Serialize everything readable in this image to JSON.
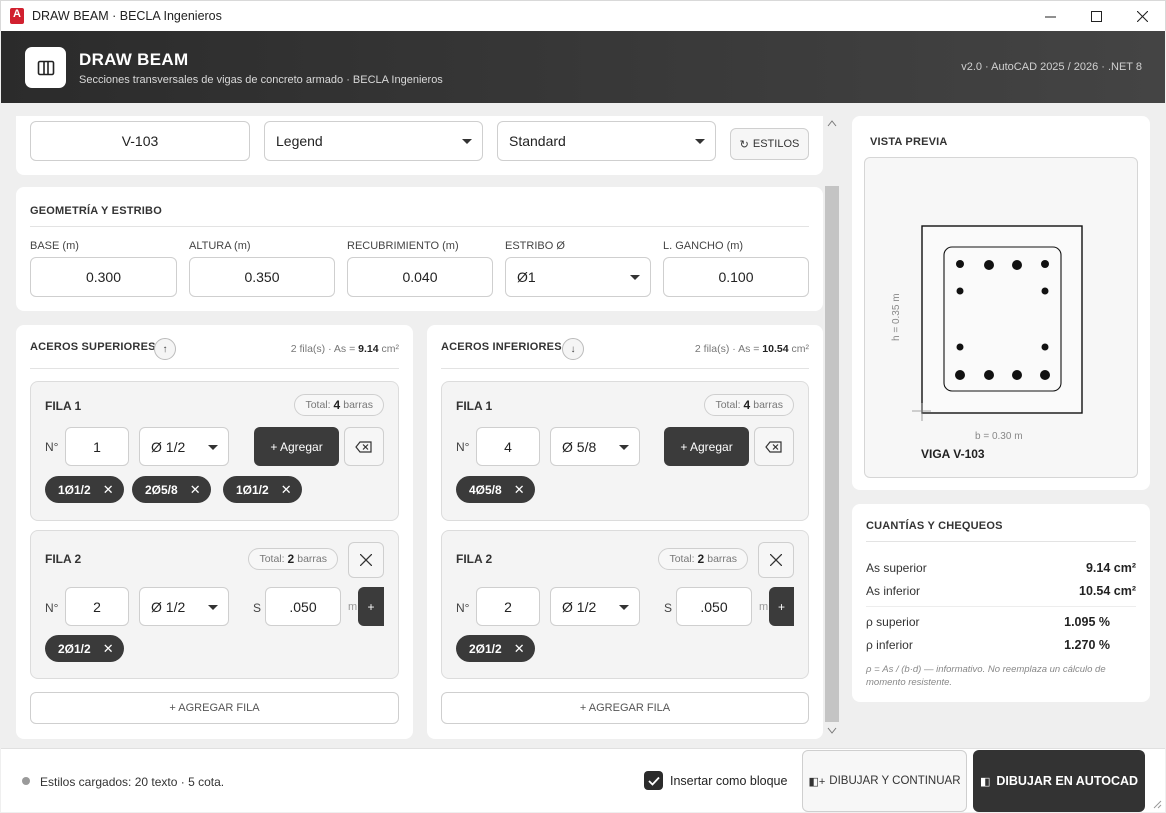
{
  "window": {
    "title": "DRAW BEAM · BECLA Ingenieros",
    "logo_letter": "A"
  },
  "header": {
    "title": "DRAW BEAM",
    "subtitle": "Secciones transversales de vigas de concreto armado · BECLA Ingenieros",
    "version": "v2.0 · AutoCAD 2025 / 2026 · .NET 8"
  },
  "top_bar": {
    "beam_name": "V-103",
    "layer_select": "Legend",
    "style_select": "Standard",
    "styles_button": "ESTILOS",
    "styles_icon": "↻"
  },
  "geometry": {
    "title": "GEOMETRÍA Y ESTRIBO",
    "fields": [
      {
        "label": "BASE (m)",
        "value": "0.300"
      },
      {
        "label": "ALTURA (m)",
        "value": "0.350"
      },
      {
        "label": "RECUBRIMIENTO (m)",
        "value": "0.040"
      },
      {
        "label": "ESTRIBO Ø",
        "value": "Ø1"
      },
      {
        "label": "L. GANCHO (m)",
        "value": "0.100"
      }
    ]
  },
  "top_steel": {
    "title": "ACEROS SUPERIORES",
    "arrow": "↑",
    "rows_text": "2 fila(s) · As =",
    "as_value": "9.14",
    "as_unit": "cm²",
    "rows": [
      {
        "title": "FILA 1",
        "total_label": "Total:",
        "total_value": "4",
        "total_unit": "barras",
        "n_label": "N°",
        "n_value": "1",
        "dia": "Ø 1/2",
        "add_label": "+ Agregar",
        "chips": [
          "1Ø1/2",
          "2Ø5/8",
          "1Ø1/2"
        ]
      },
      {
        "title": "FILA 2",
        "total_label": "Total:",
        "total_value": "2",
        "total_unit": "barras",
        "n_label": "N°",
        "n_value": "2",
        "dia": "Ø 1/2",
        "s_label": "S",
        "s_value": ".050",
        "s_unit": "m",
        "add_short": "+",
        "chips": [
          "2Ø1/2"
        ]
      }
    ],
    "add_row": "+ AGREGAR FILA"
  },
  "bottom_steel": {
    "title": "ACEROS INFERIORES",
    "arrow": "↓",
    "rows_text": "2 fila(s) · As =",
    "as_value": "10.54",
    "as_unit": "cm²",
    "rows": [
      {
        "title": "FILA 1",
        "total_label": "Total:",
        "total_value": "4",
        "total_unit": "barras",
        "n_label": "N°",
        "n_value": "4",
        "dia": "Ø 5/8",
        "add_label": "+ Agregar",
        "chips": [
          "4Ø5/8"
        ]
      },
      {
        "title": "FILA 2",
        "total_label": "Total:",
        "total_value": "2",
        "total_unit": "barras",
        "n_label": "N°",
        "n_value": "2",
        "dia": "Ø 1/2",
        "s_label": "S",
        "s_value": ".050",
        "s_unit": "m",
        "add_short": "+",
        "chips": [
          "2Ø1/2"
        ]
      }
    ],
    "add_row": "+ AGREGAR FILA"
  },
  "preview": {
    "title": "VISTA PREVIA",
    "h_label": "h = 0.35 m",
    "b_label": "b = 0.30 m",
    "beam_label": "VIGA V-103"
  },
  "checks": {
    "title": "CUANTÍAS Y CHEQUEOS",
    "rows": [
      {
        "label": "As superior",
        "value": "9.14 cm²"
      },
      {
        "label": "As inferior",
        "value": "10.54 cm²"
      },
      {
        "label": "ρ superior",
        "value": "1.095 %"
      },
      {
        "label": "ρ inferior",
        "value": "1.270 %"
      }
    ],
    "note": "ρ = As / (b·d) — informativo. No reemplaza un cálculo de momento resistente."
  },
  "footer": {
    "status": "Estilos cargados: 20 texto · 5 cota.",
    "insert_block_label": "Insertar como bloque",
    "insert_block_checked": true,
    "draw_continue": "DIBUJAR Y CONTINUAR",
    "draw_continue_icon": "◧+",
    "draw_autocad": "DIBUJAR EN AUTOCAD",
    "draw_autocad_icon": "◧"
  }
}
